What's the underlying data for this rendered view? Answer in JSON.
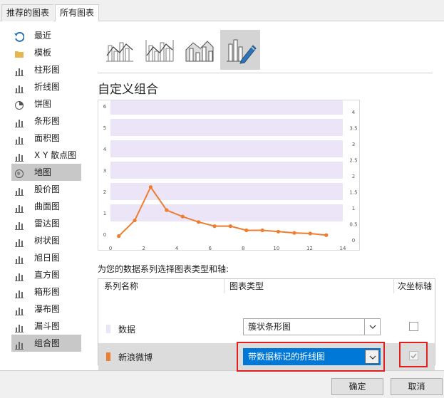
{
  "tabs": [
    {
      "label": "推荐的图表",
      "active": false
    },
    {
      "label": "所有图表",
      "active": true
    }
  ],
  "sidebar": {
    "items": [
      {
        "label": "最近",
        "icon": "recent-icon",
        "selected": false
      },
      {
        "label": "模板",
        "icon": "folder-icon",
        "selected": false
      },
      {
        "label": "柱形图",
        "icon": "column-chart-icon",
        "selected": false
      },
      {
        "label": "折线图",
        "icon": "line-chart-icon",
        "selected": false
      },
      {
        "label": "饼图",
        "icon": "pie-chart-icon",
        "selected": false
      },
      {
        "label": "条形图",
        "icon": "bar-chart-icon",
        "selected": false
      },
      {
        "label": "面积图",
        "icon": "area-chart-icon",
        "selected": false
      },
      {
        "label": "X Y 散点图",
        "icon": "scatter-chart-icon",
        "selected": false
      },
      {
        "label": "地图",
        "icon": "map-chart-icon",
        "selected": true
      },
      {
        "label": "股价图",
        "icon": "stock-chart-icon",
        "selected": false
      },
      {
        "label": "曲面图",
        "icon": "surface-chart-icon",
        "selected": false
      },
      {
        "label": "雷达图",
        "icon": "radar-chart-icon",
        "selected": false
      },
      {
        "label": "树状图",
        "icon": "treemap-chart-icon",
        "selected": false
      },
      {
        "label": "旭日图",
        "icon": "sunburst-chart-icon",
        "selected": false
      },
      {
        "label": "直方图",
        "icon": "histogram-chart-icon",
        "selected": false
      },
      {
        "label": "箱形图",
        "icon": "box-whisker-chart-icon",
        "selected": false
      },
      {
        "label": "瀑布图",
        "icon": "waterfall-chart-icon",
        "selected": false
      },
      {
        "label": "漏斗图",
        "icon": "funnel-chart-icon",
        "selected": false
      },
      {
        "label": "组合图",
        "icon": "combo-chart-icon",
        "selected": true
      }
    ]
  },
  "subtypes": [
    {
      "icon": "clustered-column-line-icon",
      "selected": false
    },
    {
      "icon": "clustered-column-line-secondary-axis-icon",
      "selected": false
    },
    {
      "icon": "stacked-area-clustered-column-icon",
      "selected": false
    },
    {
      "icon": "custom-combination-icon",
      "selected": true
    }
  ],
  "combo_title": "自定义组合",
  "chart_data": {
    "type": "bar",
    "series": [
      {
        "name": "数据",
        "chart": "horizontal bar",
        "axis": "primary",
        "color": "#ebe5f7",
        "categories": [
          1,
          2,
          3,
          4,
          5,
          6
        ],
        "values": [
          14,
          14,
          14,
          14,
          14,
          14
        ]
      },
      {
        "name": "新浪微博",
        "chart": "line with markers",
        "axis": "secondary",
        "color": "#ed7d31",
        "values": [
          0.12,
          0.61,
          1.65,
          0.93,
          0.73,
          0.56,
          0.43,
          0.43,
          0.3,
          0.3,
          0.26,
          0.22,
          0.2,
          0.15
        ]
      }
    ],
    "x_ticks": [
      "0",
      "2",
      "4",
      "6",
      "8",
      "10",
      "12",
      "14"
    ],
    "y_left_ticks": [
      "0",
      "1",
      "2",
      "3",
      "4",
      "5",
      "6"
    ],
    "y_right_ticks": [
      "0",
      "0.5",
      "1",
      "1.5",
      "2",
      "2.5",
      "3",
      "3.5",
      "4"
    ],
    "xlim": [
      0,
      14
    ],
    "ylim_left": [
      0,
      6
    ],
    "ylim_right": [
      0,
      4
    ]
  },
  "series_prompt": "为您的数据系列选择图表类型和轴:",
  "table": {
    "headers": [
      "系列名称",
      "图表类型",
      "次坐标轴"
    ],
    "rows": [
      {
        "name": "数据",
        "swatch": "#ebe5f7",
        "chart_type": "簇状条形图",
        "secondary_axis": false,
        "selected": false
      },
      {
        "name": "新浪微博",
        "swatch": "#ed7d31",
        "chart_type": "带数据标记的折线图",
        "secondary_axis": true,
        "selected": true
      }
    ]
  },
  "buttons": {
    "ok": "确定",
    "cancel": "取消"
  },
  "colors": {
    "accent": "#0078d7",
    "highlight_outline": "#e02020",
    "series_orange": "#ed7d31",
    "band_purple": "#ebe5f7"
  }
}
